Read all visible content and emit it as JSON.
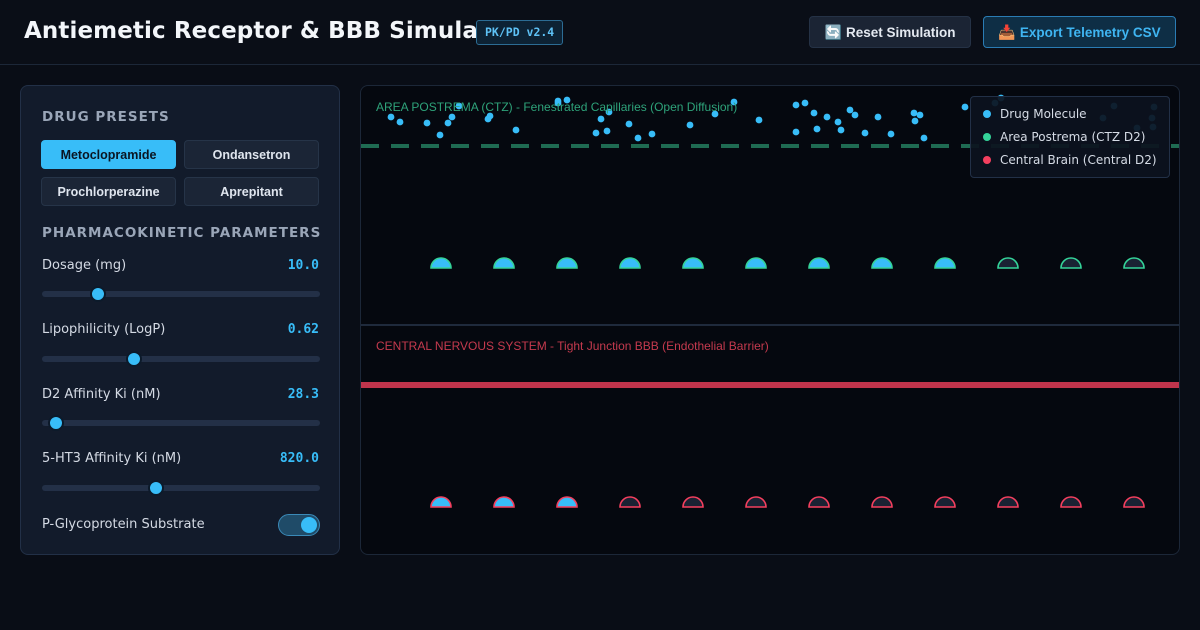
{
  "header": {
    "title": "Antiemetic Receptor & BBB Simulator",
    "version_badge": "PK/PD v2.4",
    "reset_label": "Reset Simulation",
    "export_label": "Export Telemetry CSV",
    "reset_icon": "🔄",
    "export_icon": "📥"
  },
  "sidebar": {
    "presets_title": "DRUG PRESETS",
    "presets": [
      {
        "label": "Metoclopramide",
        "active": true
      },
      {
        "label": "Ondansetron",
        "active": false
      },
      {
        "label": "Prochlorperazine",
        "active": false
      },
      {
        "label": "Aprepitant",
        "active": false
      }
    ],
    "params_title": "PHARMACOKINETIC PARAMETERS",
    "params": [
      {
        "label": "Dosage (mg)",
        "value": "10.0",
        "fraction": 0.2
      },
      {
        "label": "Lipophilicity (LogP)",
        "value": "0.62",
        "fraction": 0.33
      },
      {
        "label": "D2 Affinity Ki (nM)",
        "value": "28.3",
        "fraction": 0.05
      },
      {
        "label": "5-HT3 Affinity Ki (nM)",
        "value": "820.0",
        "fraction": 0.41
      }
    ],
    "pgp_label": "P-Glycoprotein Substrate",
    "pgp_enabled": true
  },
  "simulation": {
    "ctz_label": "AREA POSTREMA (CTZ) - Fenestrated Capillaries (Open Diffusion)",
    "cns_label": "CENTRAL NERVOUS SYSTEM - Tight Junction BBB (Endothelial Barrier)",
    "legend": [
      {
        "label": "Drug Molecule",
        "color": "#38bdf8"
      },
      {
        "label": "Area Postrema (CTZ D2)",
        "color": "#34d399"
      },
      {
        "label": "Central Brain (Central D2)",
        "color": "#f43f5e"
      }
    ],
    "ctz_receptors_bound": [
      true,
      true,
      true,
      true,
      true,
      true,
      true,
      true,
      true,
      false,
      false,
      false
    ],
    "cns_receptors_bound": [
      true,
      true,
      true,
      false,
      false,
      false,
      false,
      false,
      false,
      false,
      false,
      false
    ],
    "colors": {
      "molecule": "#38bdf8",
      "ctz_barrier": "#1f6b52",
      "cns_barrier": "#c0344c",
      "ctz_receptor": "#34d399",
      "cns_receptor": "#f43f5e",
      "ctz_label": "#2ea37a",
      "cns_label": "#c53a4e"
    }
  }
}
